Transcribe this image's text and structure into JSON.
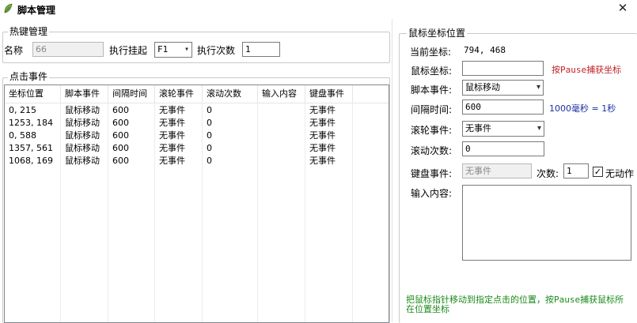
{
  "window": {
    "title": "脚本管理",
    "close_glyph": "✕"
  },
  "hotkey_group": {
    "title": "热键管理",
    "name_label": "名称",
    "name_value": "66",
    "exec_label": "执行挂起",
    "exec_value": "F1",
    "count_label": "执行次数",
    "count_value": "1"
  },
  "click_events": {
    "title": "点击事件",
    "columns": [
      "坐标位置",
      "脚本事件",
      "间隔时间",
      "滚轮事件",
      "滚动次数",
      "输入内容",
      "键盘事件"
    ],
    "rows": [
      [
        "0, 215",
        "鼠标移动",
        "600",
        "无事件",
        "0",
        "",
        "无事件"
      ],
      [
        "1253, 184",
        "鼠标移动",
        "600",
        "无事件",
        "0",
        "",
        "无事件"
      ],
      [
        "0, 588",
        "鼠标移动",
        "600",
        "无事件",
        "0",
        "",
        "无事件"
      ],
      [
        "1357, 561",
        "鼠标移动",
        "600",
        "无事件",
        "0",
        "",
        "无事件"
      ],
      [
        "1068, 169",
        "鼠标移动",
        "600",
        "无事件",
        "0",
        "",
        "无事件"
      ]
    ]
  },
  "mouse_panel": {
    "title": "鼠标坐标位置",
    "current_label": "当前坐标:",
    "current_value": "794, 468",
    "coord_label": "鼠标坐标:",
    "coord_value": "",
    "coord_hint": "按Pause捕获坐标",
    "script_event_label": "脚本事件:",
    "script_event_value": "鼠标移动",
    "interval_label": "间隔时间:",
    "interval_value": "600",
    "interval_hint": "1000毫秒 = 1秒",
    "wheel_label": "滚轮事件:",
    "wheel_value": "无事件",
    "scroll_label": "滚动次数:",
    "scroll_value": "0",
    "key_label": "键盘事件:",
    "key_value": "无事件",
    "times_label": "次数:",
    "times_value": "1",
    "no_action_label": "无动作",
    "no_action_checked": true,
    "input_label": "输入内容:",
    "input_value": "",
    "bottom_hint": "把鼠标指针移动到指定点击的位置，按Pause捕获鼠标所在位置坐标"
  },
  "colors": {
    "hint_red": "#c0202a",
    "hint_blue": "#1a2fa0",
    "hint_green": "#1a8a1a"
  }
}
